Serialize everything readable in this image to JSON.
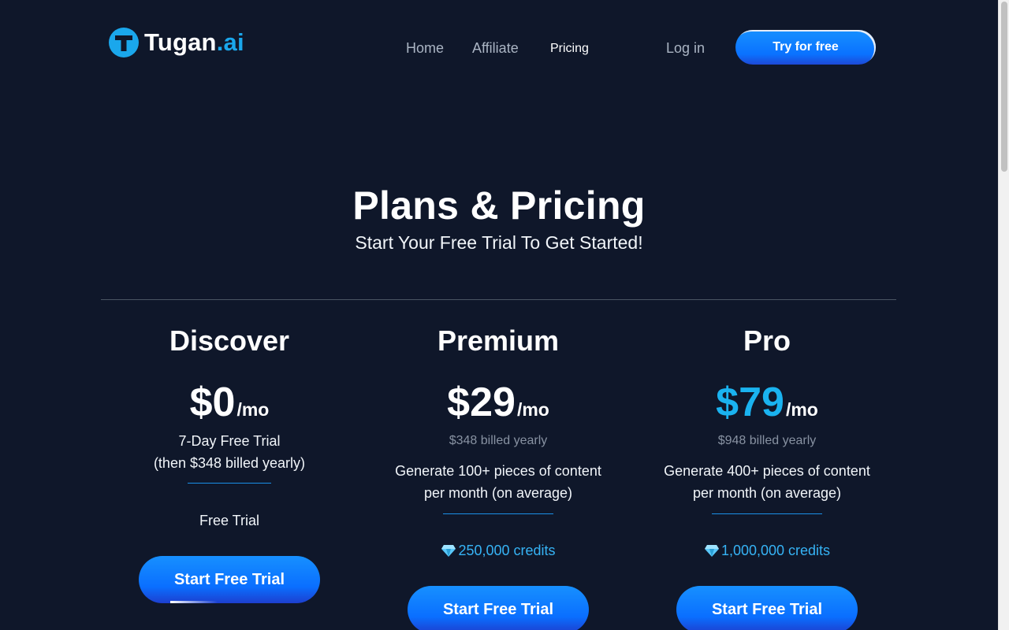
{
  "header": {
    "logo": {
      "name": "Tugan",
      "tld": ".ai"
    },
    "nav": [
      {
        "label": "Home"
      },
      {
        "label": "Affiliate"
      },
      {
        "label": "Pricing"
      }
    ],
    "login_label": "Log in",
    "cta_label": "Try for free"
  },
  "hero": {
    "title": "Plans & Pricing",
    "subtitle": "Start Your Free Trial To Get Started!"
  },
  "plans": [
    {
      "name": "Discover",
      "price": "$0",
      "period": "/mo",
      "trial_line1": "7-Day Free Trial",
      "trial_line2": "(then $348 billed yearly)",
      "feature": "Free Trial",
      "button": "Start Free Trial"
    },
    {
      "name": "Premium",
      "price": "$29",
      "period": "/mo",
      "billed": "$348 billed yearly",
      "desc_line1": "Generate 100+ pieces of content",
      "desc_line2": "per month (on average)",
      "credits": "250,000 credits",
      "button": "Start Free Trial"
    },
    {
      "name": "Pro",
      "price": "$79",
      "period": "/mo",
      "billed": "$948 billed yearly",
      "desc_line1": "Generate 400+ pieces of content",
      "desc_line2": "per month (on average)",
      "credits": "1,000,000 credits",
      "button": "Start Free Trial"
    }
  ],
  "colors": {
    "background": "#0f172a",
    "accent": "#1ab3f0",
    "button": "#0a72ff",
    "muted": "#8892a2"
  },
  "icons": [
    "tugan-logo-icon",
    "diamond-icon"
  ]
}
